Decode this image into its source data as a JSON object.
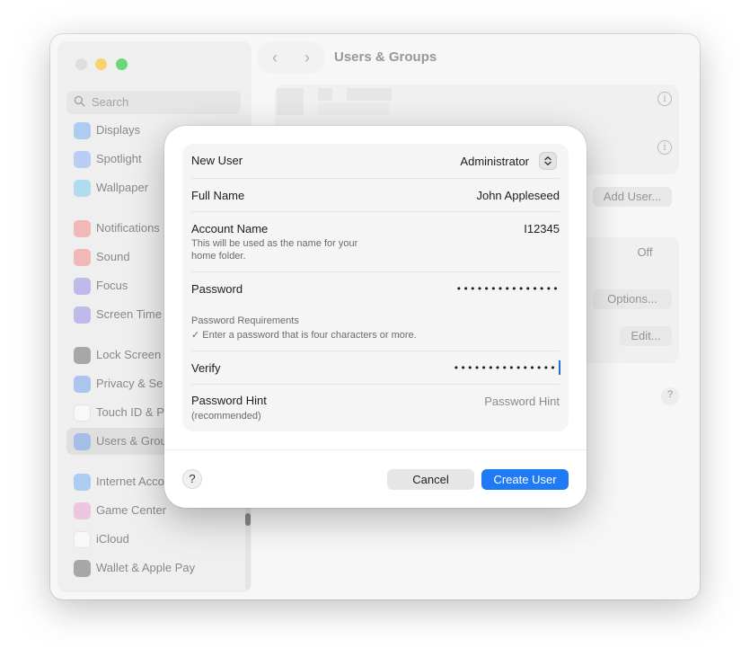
{
  "window": {
    "title": "Users & Groups",
    "search_placeholder": "Search",
    "sidebar_items": [
      {
        "label": "Displays",
        "icon": "displays-icon",
        "color": "#3c8ef0"
      },
      {
        "label": "Spotlight",
        "icon": "spotlight-icon",
        "color": "#5f8ff2"
      },
      {
        "label": "Wallpaper",
        "icon": "wallpaper-icon",
        "color": "#43b6e8"
      },
      {
        "label": "Notifications",
        "icon": "notifications-icon",
        "color": "#ec5a58"
      },
      {
        "label": "Sound",
        "icon": "sound-icon",
        "color": "#ec5a58"
      },
      {
        "label": "Focus",
        "icon": "focus-icon",
        "color": "#6a5fd8"
      },
      {
        "label": "Screen Time",
        "icon": "screen-time-icon",
        "color": "#6a5fd8"
      },
      {
        "label": "Lock Screen",
        "icon": "lock-screen-icon",
        "color": "#2d2d2d"
      },
      {
        "label": "Privacy & Se",
        "icon": "privacy-icon",
        "color": "#3b7be8"
      },
      {
        "label": "Touch ID & P",
        "icon": "touch-id-icon",
        "color": "#ffffff"
      },
      {
        "label": "Users & Grou",
        "icon": "users-groups-icon",
        "color": "#3b7be8",
        "selected": true
      },
      {
        "label": "Internet Acco",
        "icon": "internet-accounts-icon",
        "color": "#3b8ef0"
      },
      {
        "label": "Game Center",
        "icon": "game-center-icon",
        "color": "#e37ac3"
      },
      {
        "label": "iCloud",
        "icon": "icloud-icon",
        "color": "#ffffff"
      },
      {
        "label": "Wallet & Apple Pay",
        "icon": "wallet-icon",
        "color": "#2d2d2d"
      }
    ],
    "background_buttons": {
      "add_user": "Add User...",
      "off": "Off",
      "options": "Options...",
      "edit": "Edit..."
    }
  },
  "dialog": {
    "rows": {
      "new_user": {
        "label": "New User",
        "value": "Administrator"
      },
      "full_name": {
        "label": "Full Name",
        "value": "John Appleseed"
      },
      "account_name": {
        "label": "Account Name",
        "value": "I12345",
        "sub_line1": "This will be used as the name for your",
        "sub_line2": "home folder."
      },
      "password": {
        "label": "Password",
        "value": "•••••••••••••••"
      },
      "requirements": {
        "title": "Password Requirements",
        "item": "✓ Enter a password that is four characters or more."
      },
      "verify": {
        "label": "Verify",
        "value": "•••••••••••••••"
      },
      "hint": {
        "label": "Password Hint",
        "sub": "(recommended)",
        "placeholder": "Password Hint"
      }
    },
    "help_label": "?",
    "cancel_label": "Cancel",
    "create_label": "Create User"
  }
}
